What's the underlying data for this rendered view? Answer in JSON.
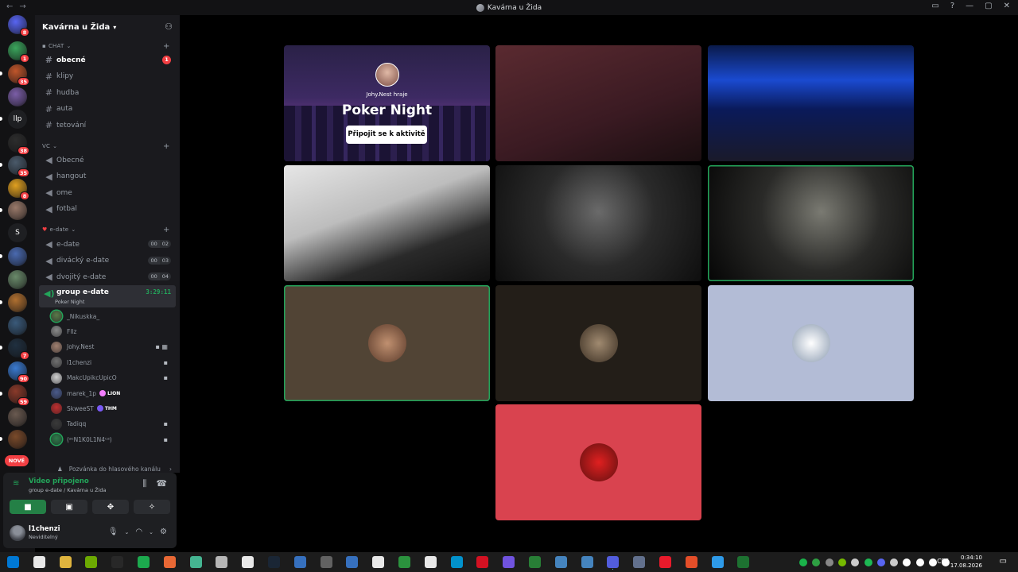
{
  "window": {
    "title": "Kavárna u Žida",
    "back": "←",
    "forward": "→"
  },
  "guilds": [
    {
      "name": "direct-messages",
      "badge": "8",
      "color": "#5865f2"
    },
    {
      "name": "server-1",
      "badge": "1",
      "color": "#3ba55c"
    },
    {
      "name": "server-2",
      "badge": "35",
      "color": "#c0562b"
    },
    {
      "name": "server-3",
      "badge": "",
      "color": "#7b5ea7"
    },
    {
      "name": "llp",
      "badge": "",
      "color": "#1e1f22",
      "text": "llp"
    },
    {
      "name": "server-5",
      "badge": "38",
      "color": "#2d2d2d"
    },
    {
      "name": "server-6",
      "badge": "35",
      "color": "#4a5a6a"
    },
    {
      "name": "server-7",
      "badge": "8",
      "color": "#e0a020"
    },
    {
      "name": "server-8",
      "badge": "",
      "color": "#9a7a6a"
    },
    {
      "name": "s",
      "badge": "",
      "color": "#1e1f22",
      "text": "S"
    },
    {
      "name": "server-10",
      "badge": "",
      "color": "#4a6ab0"
    },
    {
      "name": "server-11",
      "badge": "",
      "color": "#6a8a6a"
    },
    {
      "name": "server-12",
      "badge": "",
      "color": "#b07030"
    },
    {
      "name": "server-13",
      "badge": "",
      "color": "#3a5a7a"
    },
    {
      "name": "server-14",
      "badge": "7",
      "color": "#203040"
    },
    {
      "name": "server-15",
      "badge": "90",
      "color": "#3a7ad0"
    },
    {
      "name": "server-16",
      "badge": "59",
      "color": "#8a3a2a"
    },
    {
      "name": "server-17",
      "badge": "",
      "color": "#6a5a50"
    },
    {
      "name": "server-18",
      "badge": "",
      "color": "#7a4a2a"
    }
  ],
  "new_badge": "NOVÉ",
  "server": {
    "name": "Kavárna u Žida"
  },
  "categories": {
    "chat": "CHAT",
    "vc": "VC",
    "edate": "e-date"
  },
  "text_channels": [
    {
      "name": "obecné",
      "mention": "1"
    },
    {
      "name": "klipy"
    },
    {
      "name": "hudba"
    },
    {
      "name": "auta"
    },
    {
      "name": "tetování"
    }
  ],
  "vc_channels": [
    "Obecné",
    "hangout",
    "ome",
    "fotbal"
  ],
  "edate_channels": [
    {
      "name": "e-date",
      "a": "00",
      "b": "02"
    },
    {
      "name": "divácký e-date",
      "a": "00",
      "b": "03"
    },
    {
      "name": "dvojitý e-date",
      "a": "00",
      "b": "04"
    }
  ],
  "active_channel": {
    "name": "group e-date",
    "timer": "3:29:11",
    "activity": "Poker Night"
  },
  "voice_users": [
    {
      "name": "_Nikuskka_",
      "speaking": true,
      "color": "#5a7a4a"
    },
    {
      "name": "Fllz",
      "color": "#8a8a8a"
    },
    {
      "name": "Johy.Nest",
      "color": "#a08070",
      "icons": "▪ ▦"
    },
    {
      "name": "l1chenzi",
      "color": "#707070",
      "icons": "▪"
    },
    {
      "name": "MakcUpikcUpicO",
      "color": "#d0d0d0",
      "icons": "▪"
    },
    {
      "name": "marek_1p",
      "color": "#4a5a8a",
      "tag": "LION",
      "tagcolor": "#f47fff"
    },
    {
      "name": "SkweeST",
      "color": "#c03030",
      "tag": "THM",
      "tagcolor": "#7a5af5"
    },
    {
      "name": "Tadiqq",
      "color": "#3a3a3a",
      "icons": "▪"
    },
    {
      "name": "(ᵃᶜN1K0L1N4ᶜᵃ)",
      "speaking": true,
      "color": "#2e7a4a",
      "icons": "▪"
    }
  ],
  "invite_row": "Pozvánka do hlasového kanálu",
  "voice_panel": {
    "status": "Video připojeno",
    "sub": "group e-date / Kavárna u Žida"
  },
  "user_panel": {
    "name": "l1chenzi",
    "status": "Neviditelný"
  },
  "activity_tile": {
    "host": "Johy.Nest hraje",
    "title": "Poker Night",
    "button": "Připojit se k aktivitě"
  },
  "tiles": [
    {
      "name": "activity"
    },
    {
      "name": "video-girl-red",
      "bg": "linear-gradient(160deg,#5a2a30,#3a1a22 60%,#1a0e10)"
    },
    {
      "name": "video-blue-room",
      "bg": "linear-gradient(180deg,#0a1a4a,#1a4ad0 30%,#0a1a5a 55%,#1a1a2a)"
    },
    {
      "name": "video-girl-white",
      "bg": "linear-gradient(160deg,#e6e6e6,#bdbdbd 40%,#2a2a2a 70%,#101010)"
    },
    {
      "name": "video-boy-glasses",
      "bg": "radial-gradient(circle at 50% 40%,#6a6a6a,#2a2a2a 45%,#0e0e0e)"
    },
    {
      "name": "video-girl-dark",
      "bg": "radial-gradient(circle at 55% 40%,#7a7a72,#2a2a28 45%,#050505)",
      "speaking": true
    },
    {
      "name": "avatar-tile-brown",
      "bg": "#514435",
      "av": "radial-gradient(circle,#c09070,#5a3a2a)",
      "speaking": true
    },
    {
      "name": "avatar-tile-soldier",
      "bg": "#231e18",
      "av": "radial-gradient(circle,#a08a70,#3a2e22)"
    },
    {
      "name": "avatar-tile-car",
      "bg": "#b3bcd6",
      "av": "radial-gradient(circle,#ffffff,#8a9ab0)"
    },
    {
      "name": "avatar-tile-red",
      "bg": "#d9434f",
      "av": "radial-gradient(circle,#e02020,#601010)"
    }
  ],
  "tray": {
    "lang": "CES",
    "time": "0:34:10",
    "date": "17.08.2026"
  }
}
